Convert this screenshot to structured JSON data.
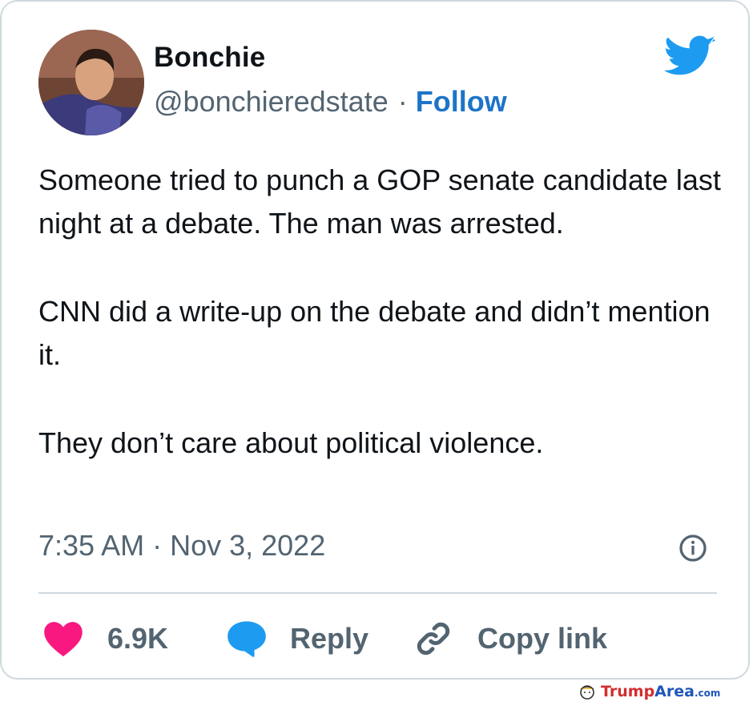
{
  "tweet": {
    "author": {
      "display_name": "Bonchie",
      "handle": "@bonchieredstate",
      "separator": "·",
      "follow_label": "Follow"
    },
    "paragraphs": [
      "Someone tried to punch a GOP senate candidate last night at a debate. The man was arrested.",
      "CNN did a write-up on the debate and didn’t mention it.",
      "They don’t care about political violence."
    ],
    "time": "7:35 AM",
    "date_separator": "·",
    "date": "Nov 3, 2022",
    "actions": {
      "likes": "6.9K",
      "reply_label": "Reply",
      "copy_label": "Copy link"
    }
  },
  "watermark": {
    "part1": "Trump",
    "part2": "Area",
    "part3": ".com"
  },
  "colors": {
    "text": "#0f1419",
    "secondary": "#536471",
    "follow": "#1d74c8",
    "twitter_blue": "#1d9bf0",
    "like_pink": "#f91880",
    "border": "#cfd9de"
  },
  "icons": [
    "twitter-bird-icon",
    "info-icon",
    "heart-icon",
    "speech-bubble-icon",
    "link-icon",
    "trumparea-logo-icon"
  ]
}
